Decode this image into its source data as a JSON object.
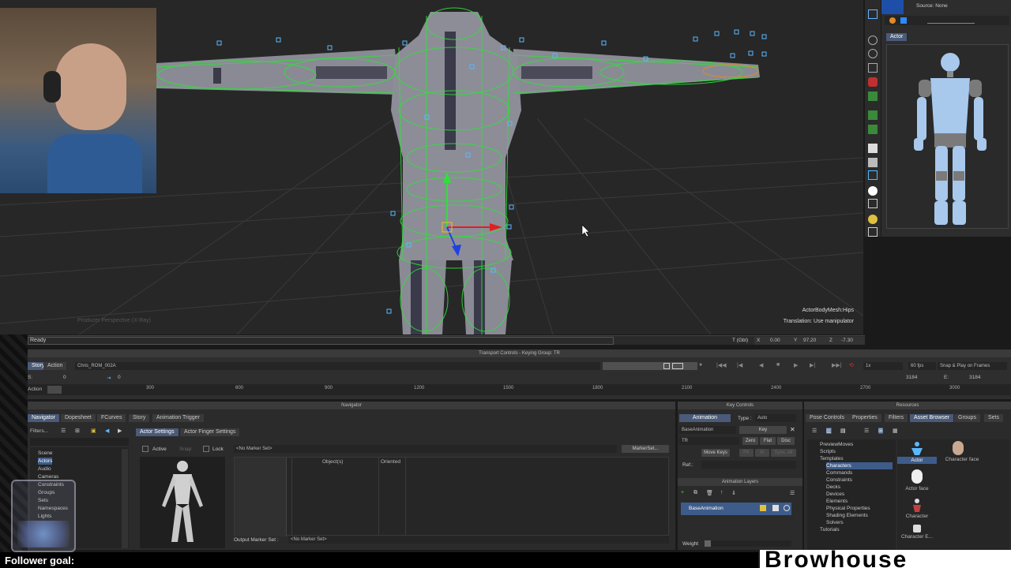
{
  "viewport": {
    "camera_label": "Producer Perspective (X-Ray)",
    "selected_object": "ActorBodyMesh:Hips",
    "hint": "Translation: Use manipulator"
  },
  "status": {
    "ready": "Ready",
    "coord_mode": "T (Gbl)",
    "x_label": "X",
    "x_value": "0.00",
    "y_label": "Y",
    "y_value": "97.20",
    "z_label": "Z",
    "z_value": "-7.30"
  },
  "top_right": {
    "source_label": "Source: None",
    "actor_tab": "Actor"
  },
  "transport": {
    "title": "Transport Controls  -  Keying Group: TR",
    "story_tab": "Story",
    "action_tab": "Action",
    "take_name": "Chris_ROM_002A",
    "speed": "1x",
    "fps": "60 fps",
    "snap_mode": "Snap & Play on Frames",
    "s_label": "S:",
    "s_value": "0",
    "frame_value": "0",
    "end_value": "3184",
    "e_label": "E:",
    "e_value": "3184",
    "action_label": "Action",
    "ruler": [
      "300",
      "600",
      "900",
      "1200",
      "1500",
      "1800",
      "2100",
      "2400",
      "2700",
      "3000"
    ]
  },
  "navigator": {
    "title": "Navigator",
    "tabs": [
      "Navigator",
      "Dopesheet",
      "FCurves",
      "Story",
      "Animation Trigger"
    ],
    "filters_label": "Filters...",
    "tree": [
      "Scene",
      "Actors",
      "Audio",
      "Cameras",
      "Constraints",
      "Groups",
      "Sets",
      "Namespaces",
      "Lights"
    ],
    "settings_tabs": [
      "Actor Settings",
      "Actor Finger Settings"
    ],
    "active_label": "Active",
    "snap_label": "Snap",
    "lock_label": "Lock",
    "marker_set": "<No Marker Set>",
    "marker_set_btn": "MarkerSet...",
    "col_objects": "Object(s)",
    "col_oriented": "Oriented",
    "output_marker_label": "Output Marker Set :",
    "output_marker_value": "<No Marker Set>"
  },
  "key_controls": {
    "title": "Key Controls",
    "animation_tab": "Animation",
    "type_label": "Type :",
    "type_value": "Auto",
    "layer_value": "BaseAnimation",
    "key_btn": "Key",
    "tr_value": "TR",
    "zero_btn": "Zero",
    "flat_btn": "Flat",
    "disc_btn": "Disc",
    "move_keys_btn": "Move Keys",
    "fk_btn": "FK",
    "ik_btn": "IK",
    "sync_btn": "Sync. All",
    "ref_label": "Ref.:",
    "anim_layers_title": "Animation Layers",
    "base_layer": "BaseAnimation",
    "weight_label": "Weight"
  },
  "resources": {
    "title": "Resources",
    "tabs": [
      "Pose Controls",
      "Properties",
      "Filters",
      "Asset Browser",
      "Groups",
      "Sets"
    ],
    "tree": [
      "PreviewMoves",
      "Scripts",
      "Templates",
      "Characters",
      "Commands",
      "Constraints",
      "Decks",
      "Devices",
      "Elements",
      "Physical Properties",
      "Shading Elements",
      "Solvers",
      "Tutorials"
    ],
    "assets": [
      "Actor",
      "Character face",
      "Actor face",
      "Character",
      "Character E..."
    ]
  },
  "overlay": {
    "follower_goal": "Follower goal:",
    "brand": "Browhouse"
  },
  "colors": {
    "wireframe": "#2fe03a",
    "selection": "#3e5c8a",
    "accent": "#4a5a78"
  }
}
